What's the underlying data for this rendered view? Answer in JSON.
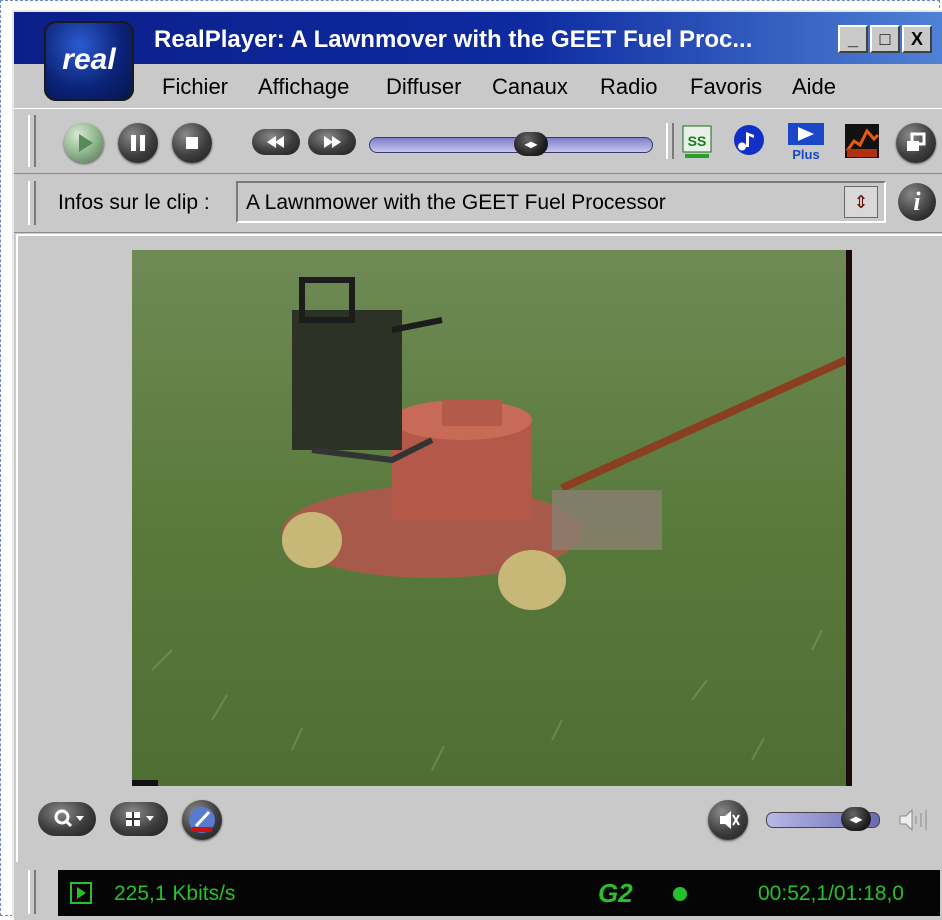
{
  "window": {
    "title": "RealPlayer: A Lawnmover with the GEET Fuel Proc...",
    "logo_text": "real",
    "buttons": {
      "minimize": "_",
      "maximize": "□",
      "close": "X"
    }
  },
  "menu": {
    "items": [
      "Fichier",
      "Affichage",
      "Diffuser",
      "Canaux",
      "Radio",
      "Favoris",
      "Aide"
    ]
  },
  "toolbar": {
    "seek_position": 0.58,
    "icons": [
      "play-icon",
      "pause-icon",
      "stop-icon",
      "rewind-icon",
      "fast-forward-icon",
      "ss-icon",
      "music-note-icon",
      "plus-icon",
      "chart-icon",
      "window-icon"
    ],
    "plus_label": "Plus",
    "ss_label": "SS"
  },
  "clip": {
    "label": "Infos sur le clip :",
    "value": "A Lawnmower with the GEET Fuel Processor",
    "info_glyph": "i"
  },
  "controls": {
    "volume_level": 0.9
  },
  "status": {
    "bitrate": "225,1 Kbits/s",
    "logo": "G2",
    "time": "00:52,1/01:18,0",
    "text_color": "#27c02a"
  }
}
